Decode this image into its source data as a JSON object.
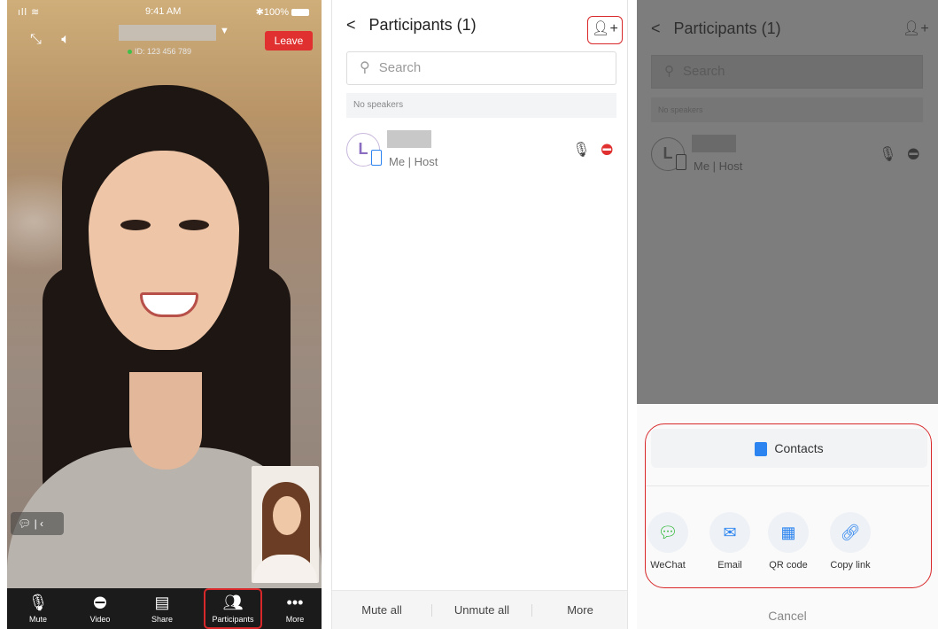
{
  "call": {
    "status_signal": "ıll ≋",
    "status_time": "9:41 AM",
    "status_battery": "✱100%",
    "meeting_id": "ID: 123 456 789",
    "leave_label": "Leave",
    "toolbar": [
      {
        "label": "Mute",
        "icon": "microphone-icon"
      },
      {
        "label": "Video",
        "icon": "video-off-icon"
      },
      {
        "label": "Share",
        "icon": "share-screen-icon"
      },
      {
        "label": "Participants",
        "icon": "participants-icon"
      },
      {
        "label": "More",
        "icon": "more-dots-icon"
      }
    ]
  },
  "participants": {
    "back": "<",
    "title": "Participants (1)",
    "search_placeholder": "Search",
    "no_speakers": "No speakers",
    "avatar_letter": "L",
    "role": "Me | Host",
    "footer": {
      "mute_all": "Mute all",
      "unmute_all": "Unmute all",
      "more": "More"
    }
  },
  "invite": {
    "contacts_label": "Contacts",
    "share_options": [
      {
        "label": "WeChat",
        "icon": "wechat-icon",
        "color": "#2db833"
      },
      {
        "label": "Email",
        "icon": "email-icon",
        "color": "#2b84f0"
      },
      {
        "label": "QR code",
        "icon": "qr-code-icon",
        "color": "#2b84f0"
      },
      {
        "label": "Copy link",
        "icon": "link-icon",
        "color": "#2b84f0"
      }
    ],
    "cancel_label": "Cancel"
  },
  "colors": {
    "accent_red": "#d8282a",
    "leave_red": "#e0302f",
    "brand_blue": "#2b84f0"
  }
}
